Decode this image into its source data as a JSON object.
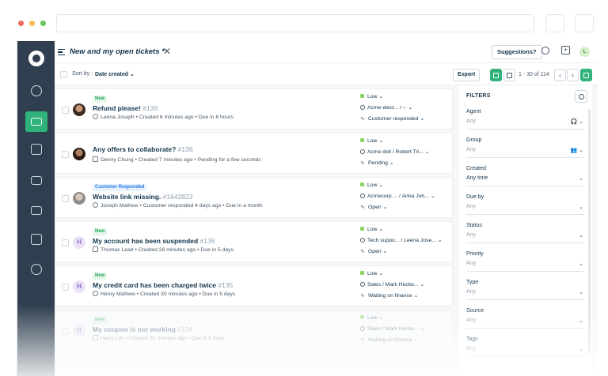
{
  "header": {
    "view_title": "New and my open tickets *",
    "close_glyph": "✕",
    "suggestions_label": "Suggestions?",
    "avatar_letter": "L"
  },
  "toolbar": {
    "sort_label": "Sort by :",
    "sort_value": "Date created ⌄",
    "export_label": "Export",
    "pager_text": "1 - 30 of 114",
    "prev_glyph": "‹",
    "next_glyph": "›"
  },
  "tickets": [
    {
      "badge": "New",
      "badge_type": "new",
      "subject": "Refund please!",
      "id": "#139",
      "meta": "Leena Joseph  •  Created 6 minutes ago  •  Due in 6 hours",
      "avatar_letter": "",
      "priority": "Low ⌄",
      "assignee": "Acme elect... / -- ⌄",
      "status": "Customer responded ⌄"
    },
    {
      "badge": "",
      "badge_type": "",
      "subject": "Any offers to collaborate?",
      "id": "#138",
      "meta": "Denny Chung  •  Created 7 minutes ago  •  Pending for a few seconds",
      "avatar_letter": "",
      "priority": "Low ⌄",
      "assignee": "Acme doll / Robert Tri... ⌄",
      "status": "Pending ⌄"
    },
    {
      "badge": "Customer Responded",
      "badge_type": "cust",
      "subject": "Website link missing.",
      "id": "#1642823",
      "meta": "Joseph Mathew  •  Customer responded 4 days ago  •  Due in a month",
      "avatar_letter": "",
      "priority": "Low ⌄",
      "assignee": "Acmecorp ... / Anna Joh... ⌄",
      "status": "Open ⌄"
    },
    {
      "badge": "New",
      "badge_type": "new",
      "subject": "My account has been suspended",
      "id": "#136",
      "meta": "Thomas Lead  •  Created 28 minutes ago  •  Due in 5 days",
      "avatar_letter": "H",
      "priority": "Low ⌄",
      "assignee": "Tech suppo... / Leena Jose... ⌄",
      "status": "Open ⌄"
    },
    {
      "badge": "New",
      "badge_type": "new",
      "subject": "My credit card has been charged twice",
      "id": "#135",
      "meta": "Henry Mathew  •  Created 30 minutes ago  •  Due in 5 days",
      "avatar_letter": "H",
      "priority": "Low ⌄",
      "assignee": "Sales / Mark Hecke... ⌄",
      "status": "Waiting on finance ⌄"
    },
    {
      "badge": "New",
      "badge_type": "new",
      "subject": "My coupon is not working",
      "id": "#134",
      "meta": "Harry Len  •  Created 31 minutes ago  •  Due in 5 days",
      "avatar_letter": "H",
      "priority": "Low ⌄",
      "assignee": "Sales / Mark Hecke... ⌄",
      "status": "Waiting on finance ⌄"
    }
  ],
  "filters": {
    "title": "FILTERS",
    "items": [
      {
        "label": "Agent",
        "value": "Any",
        "caret": "🎧 ⌄"
      },
      {
        "label": "Group",
        "value": "Any",
        "caret": "👥 ⌄"
      },
      {
        "label": "Created",
        "value": "Any time",
        "caret": "⌄"
      },
      {
        "label": "Due by",
        "value": "Any",
        "caret": "⌄"
      },
      {
        "label": "Status",
        "value": "Any",
        "caret": "⌄"
      },
      {
        "label": "Priority",
        "value": "Any",
        "caret": "⌄"
      },
      {
        "label": "Type",
        "value": "Any",
        "caret": "⌄"
      },
      {
        "label": "Source",
        "value": "Any",
        "caret": "⌄"
      },
      {
        "label": "Tags",
        "value": "Any",
        "caret": "⌄"
      }
    ]
  },
  "colors": {
    "sidebar": "#2f3f4f",
    "accent": "#2fb37a",
    "priority_low": "#8bd35f"
  },
  "icons": {
    "sidebar": [
      "logo-icon",
      "dashboard-icon",
      "tickets-icon",
      "contacts-icon",
      "solutions-icon",
      "forums-icon",
      "reports-icon",
      "settings-icon"
    ]
  }
}
